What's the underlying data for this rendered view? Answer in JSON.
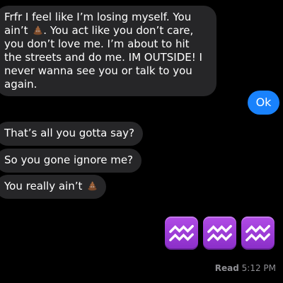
{
  "messages": [
    {
      "direction": "incoming",
      "segments": [
        {
          "type": "text",
          "value": "Frfr I feel like I’m losing myself. You ain’t "
        },
        {
          "type": "emoji",
          "icon": "pile-of-poo-icon"
        },
        {
          "type": "text",
          "value": ". You act like you don’t care, you don’t love me. I’m about to hit the streets and do me. IM OUTSIDE! I never wanna see you or talk to you again."
        }
      ]
    },
    {
      "direction": "outgoing",
      "text": "Ok"
    },
    {
      "direction": "incoming",
      "text": "That’s all you gotta say?"
    },
    {
      "direction": "incoming",
      "text": "So you gone ignore me?"
    },
    {
      "direction": "incoming",
      "segments": [
        {
          "type": "text",
          "value": "You really ain’t "
        },
        {
          "type": "emoji",
          "icon": "pile-of-poo-icon"
        }
      ]
    },
    {
      "direction": "outgoing",
      "emojis": [
        "aquarius-icon",
        "aquarius-icon",
        "aquarius-icon"
      ]
    }
  ],
  "receipt": {
    "status": "Read",
    "time": "5:12 PM"
  },
  "colors": {
    "incoming_bubble": "#262628",
    "outgoing_bubble": "#1982fc",
    "aquarius_tile": "#9b3ed8"
  }
}
